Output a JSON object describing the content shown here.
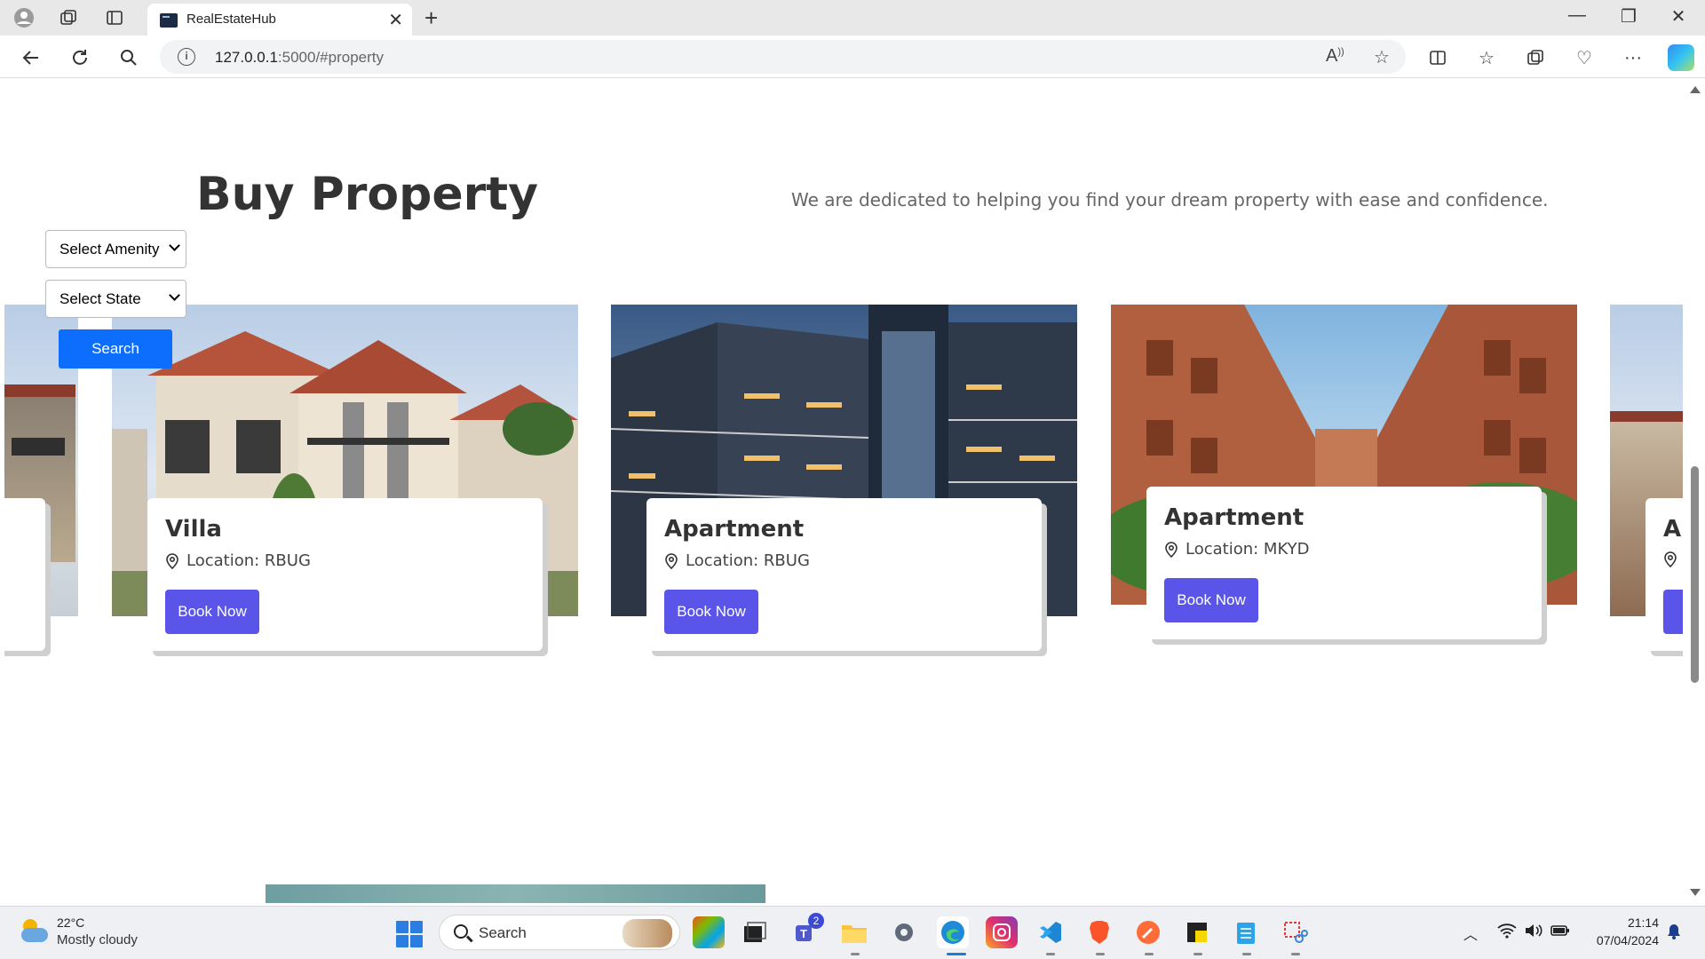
{
  "browser": {
    "tab_title": "RealEstateHub",
    "url_host": "127.0.0.1",
    "url_rest": ":5000/#property"
  },
  "page": {
    "heading": "Buy Property",
    "tagline": "We are dedicated to helping you find your dream property with ease and confidence.",
    "filters": {
      "amenity_label": "Select Amenity",
      "state_label": "Select State",
      "search_label": "Search"
    },
    "properties": [
      {
        "type": "",
        "location": "",
        "button": ""
      },
      {
        "type": "Villa",
        "location": "Location: RBUG",
        "button": "Book Now"
      },
      {
        "type": "Apartment",
        "location": "Location: RBUG",
        "button": "Book Now"
      },
      {
        "type": "Apartment",
        "location": "Location: MKYD",
        "button": "Book Now"
      },
      {
        "type": "Ap",
        "location": "",
        "button": "B"
      }
    ],
    "accent_color": "#5a55e8",
    "search_color": "#0d6efd"
  },
  "taskbar": {
    "weather_temp": "22°C",
    "weather_desc": "Mostly cloudy",
    "search_label": "Search",
    "teams_badge": "2",
    "time": "21:14",
    "date": "07/04/2024"
  }
}
